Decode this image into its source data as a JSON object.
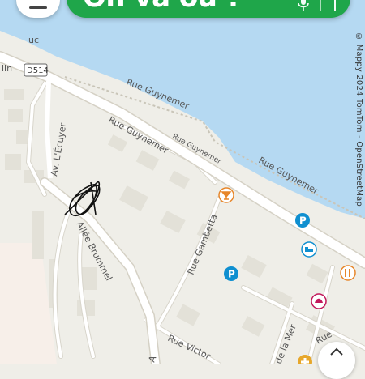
{
  "search_bar": {
    "text": "On va où ?"
  },
  "attribution": "© Mappy 2024 TomTom - OpenStreetMap",
  "labels": {
    "rue_guynemer_1": "Rue Guynemer",
    "rue_guynemer_2": "Rue Guynemer",
    "rue_guynemer_3": "Rue Guynemer",
    "rue_guynemer_4": "Rue Guynemer",
    "av_ecuyer": "Av. L'Écuyer",
    "allee_brummel": "Allée Brummel",
    "rue_gambetta": "Rue Gambetta",
    "rue_victor": "Rue Victor",
    "de_la_mer": "de la Mer",
    "rue_bottom": "Rue",
    "lin": "lin",
    "uc": "uc",
    "road_badge": "D514"
  },
  "colors": {
    "water": "#b5d9f2",
    "land": "#efeee8",
    "brand_green": "#1fa64a",
    "poi_blue": "#0f8fd0",
    "poi_orange": "#e7862a",
    "poi_pink": "#c2185b"
  },
  "pois": [
    {
      "name": "bar-icon",
      "color": "#e7862a"
    },
    {
      "name": "parking-icon",
      "color": "#0f8fd0"
    },
    {
      "name": "hotel-icon",
      "color": "#0f8fd0"
    },
    {
      "name": "restaurant-icon",
      "color": "#e7862a"
    },
    {
      "name": "bakery-icon",
      "color": "#c2185b"
    },
    {
      "name": "pharmacy-icon",
      "color": "#e7a72a"
    }
  ]
}
